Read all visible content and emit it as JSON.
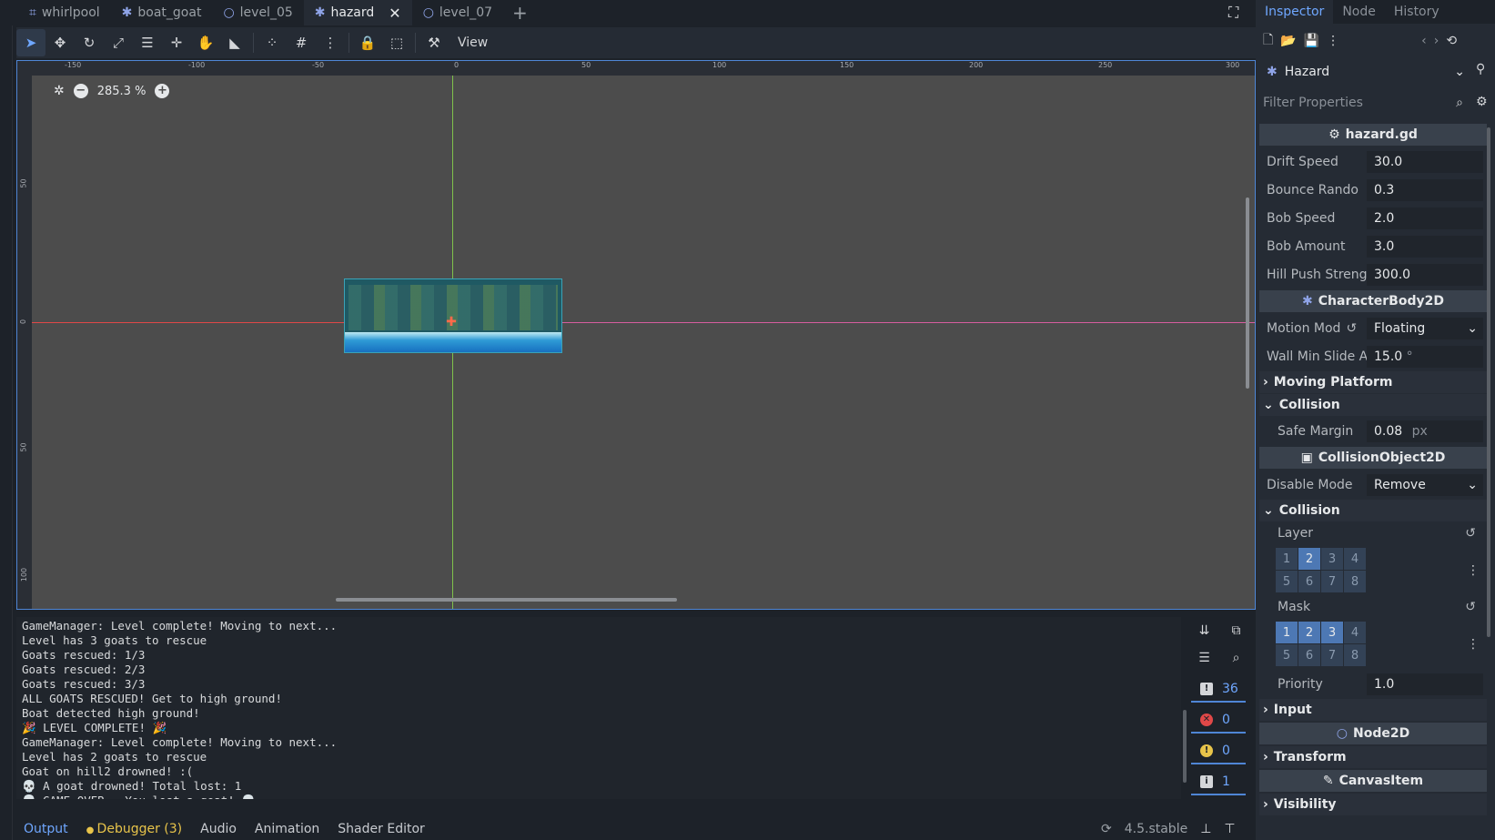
{
  "scene_tabs": [
    {
      "label": "whirlpool",
      "icon": "scene-icon"
    },
    {
      "label": "boat_goat",
      "icon": "character-icon"
    },
    {
      "label": "level_05",
      "icon": "node-circle-icon"
    },
    {
      "label": "hazard",
      "icon": "character-icon",
      "active": true
    },
    {
      "label": "level_07",
      "icon": "node-circle-icon"
    }
  ],
  "toolbar": {
    "view_label": "View"
  },
  "viewport": {
    "zoom": "285.3 %",
    "ruler_top": [
      "-150",
      "-100",
      "-50",
      "0",
      "50",
      "100",
      "150",
      "200",
      "250",
      "300"
    ],
    "ruler_left": [
      "50",
      "0",
      "50",
      "100"
    ]
  },
  "output_lines": [
    "GameManager: Level complete! Moving to next...",
    "Level has 3 goats to rescue",
    "Goats rescued: 1/3",
    "Goats rescued: 2/3",
    "Goats rescued: 3/3",
    "ALL GOATS RESCUED! Get to high ground!",
    "Boat detected high ground!",
    "🎉 LEVEL COMPLETE! 🎉",
    "GameManager: Level complete! Moving to next...",
    "Level has 2 goats to rescue",
    "Goat on hill2 drowned! :(",
    "💀 A goat drowned! Total lost: 1",
    "💀 GAME OVER - You lost a goat! 💀"
  ],
  "counters": {
    "messages": "36",
    "errors": "0",
    "warnings": "0",
    "info": "1"
  },
  "bottom_tabs": {
    "output": "Output",
    "debugger": "Debugger (3)",
    "audio": "Audio",
    "animation": "Animation",
    "shader": "Shader Editor"
  },
  "version": "4.5.stable",
  "inspector": {
    "tabs": {
      "inspector": "Inspector",
      "node": "Node",
      "history": "History"
    },
    "node_name": "Hazard",
    "filter_placeholder": "Filter Properties",
    "script_section": "hazard.gd",
    "drift_speed": {
      "label": "Drift Speed",
      "value": "30.0"
    },
    "bounce_rando": {
      "label": "Bounce Rando",
      "value": "0.3"
    },
    "bob_speed": {
      "label": "Bob Speed",
      "value": "2.0"
    },
    "bob_amount": {
      "label": "Bob Amount",
      "value": "3.0"
    },
    "hill_push": {
      "label": "Hill Push Streng",
      "value": "300.0"
    },
    "characterbody_section": "CharacterBody2D",
    "motion_mode": {
      "label": "Motion Mod",
      "value": "Floating"
    },
    "wall_min_slide": {
      "label": "Wall Min Slide A",
      "value": "15.0",
      "unit": "°"
    },
    "moving_platform": "Moving Platform",
    "collision_group": "Collision",
    "safe_margin": {
      "label": "Safe Margin",
      "value": "0.08",
      "unit": "px"
    },
    "collisionobject_section": "CollisionObject2D",
    "disable_mode": {
      "label": "Disable Mode",
      "value": "Remove"
    },
    "collision_group2": "Collision",
    "layer_label": "Layer",
    "mask_label": "Mask",
    "layer_bits": [
      "1",
      "2",
      "3",
      "4",
      "5",
      "6",
      "7",
      "8"
    ],
    "layer_on": [
      2
    ],
    "mask_on": [
      1,
      2,
      3
    ],
    "priority": {
      "label": "Priority",
      "value": "1.0"
    },
    "input_group": "Input",
    "node2d_section": "Node2D",
    "transform_group": "Transform",
    "canvasitem_section": "CanvasItem",
    "visibility_group": "Visibility"
  },
  "colors": {
    "accent": "#4f86d6",
    "debugger_dot": "#e8c44a",
    "error": "#e04848",
    "warning": "#e8c44a"
  }
}
